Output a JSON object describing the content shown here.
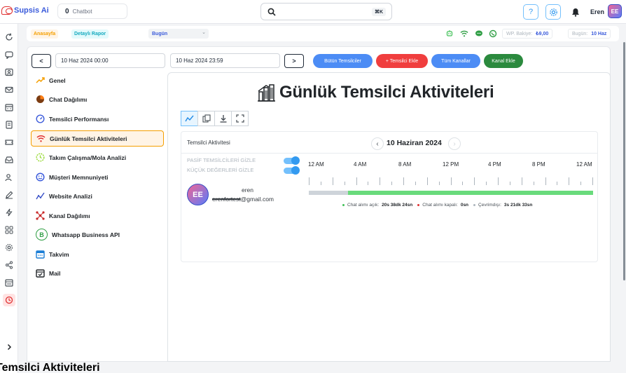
{
  "app": {
    "logo_text": "Supsis Ai",
    "chatbot_count": "0",
    "chatbot_label": "Chatbot",
    "search_shortcut": "⌘K",
    "help_label": "?",
    "user_name": "Eren",
    "avatar_initials": "EE"
  },
  "subbar": {
    "crumb_home": "Anasayfa",
    "crumb_report": "Detaylı Rapor",
    "period_selected": "Bugün",
    "wp_balance_label": "WP. Bakiye:",
    "wp_balance_value": "₺9,00",
    "today_label": "Bugün:",
    "today_value": "10 Haz"
  },
  "filters": {
    "prev_label": "<",
    "next_label": ">",
    "start_date": "10 Haz 2024 00:00",
    "end_date": "10 Haz 2024 23:59",
    "btn_all_agents": "Bütün Temsilciler",
    "btn_add_agent": "+ Temsilci Ekle",
    "btn_all_channels": "Tüm Kanallar",
    "btn_add_channel": "Kanal Ekle"
  },
  "menu": {
    "items": [
      {
        "label": "Genel"
      },
      {
        "label": "Chat Dağılımı"
      },
      {
        "label": "Temsilci Performansı"
      },
      {
        "label": "Günlük Temsilci Aktiviteleri"
      },
      {
        "label": "Takım Çalışma/Mola Analizi"
      },
      {
        "label": "Müşteri Memnuniyeti"
      },
      {
        "label": "Website Analizi"
      },
      {
        "label": "Kanal Dağılımı"
      },
      {
        "label": "Whatsapp Business API"
      },
      {
        "label": "Takvim"
      },
      {
        "label": "Mail"
      }
    ]
  },
  "panel": {
    "title": "Günlük Temsilci Aktiviteleri",
    "agent_activity_label": "Temsilci Aktivitesi",
    "current_date": "10 Haziran 2024",
    "toggle_hide_passive": "PASİF TEMSİLCİLERİ GİZLE",
    "toggle_hide_small": "KÜÇÜK DEĞERLERİ GİZLE",
    "hours": [
      "12 AM",
      "4 AM",
      "8 AM",
      "12 PM",
      "4 PM",
      "8 PM",
      "12 AM"
    ],
    "agent": {
      "name": "eren",
      "email_hidden": "erenfortest",
      "email_domain": "@gmail.com",
      "avatar_initials": "EE",
      "activity_start_fraction": 0.139,
      "activity_end_fraction": 1.0
    },
    "legend": {
      "open_label": "Chat alımı açık:",
      "open_value": "20s 38dk 24sn",
      "closed_label": "Chat alımı kapalı:",
      "closed_value": "0sn",
      "offline_label": "Çevrimdışı:",
      "offline_value": "3s 21dk 33sn"
    }
  },
  "footer": {
    "cut_title": "Temsilci Aktiviteleri"
  },
  "colors": {
    "brand": "#3b5bdb",
    "danger": "#e03131",
    "activity_green": "#69db7c",
    "offline_gray": "#ced4da",
    "accent_orange": "#f59f00"
  }
}
